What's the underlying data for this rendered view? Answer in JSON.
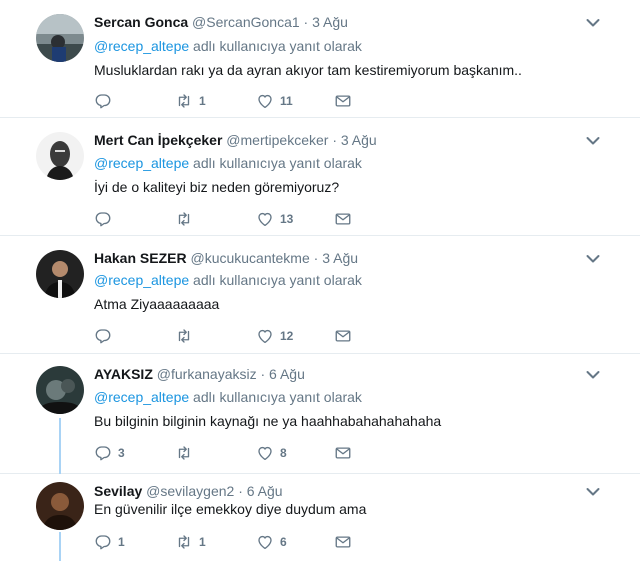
{
  "tweets": [
    {
      "name": "Sercan Gonca",
      "handle": "@SercanGonca1",
      "dot": "·",
      "time": "3 Ağu",
      "reply_mention": "@recep_altepe",
      "reply_suffix": " adlı kullanıcıya yanıt olarak",
      "text": "Musluklardan rakı ya da ayran akıyor tam kestiremiyorum başkanım..",
      "replies": "",
      "retweets": "1",
      "likes": "11"
    },
    {
      "name": "Mert Can İpekçeker",
      "handle": "@mertipekceker",
      "dot": "·",
      "time": "3 Ağu",
      "reply_mention": "@recep_altepe",
      "reply_suffix": " adlı kullanıcıya yanıt olarak",
      "text": "İyi de o kaliteyi biz neden göremiyoruz?",
      "replies": "",
      "retweets": "",
      "likes": "13"
    },
    {
      "name": "Hakan SEZER",
      "handle": "@kucukucantekme",
      "dot": "·",
      "time": "3 Ağu",
      "reply_mention": "@recep_altepe",
      "reply_suffix": " adlı kullanıcıya yanıt olarak",
      "text": "Atma Ziyaaaaaaaaa",
      "replies": "",
      "retweets": "",
      "likes": "12"
    },
    {
      "name": "AYAKSIZ",
      "handle": "@furkanayaksiz",
      "dot": "·",
      "time": "6 Ağu",
      "reply_mention": "@recep_altepe",
      "reply_suffix": " adlı kullanıcıya yanıt olarak",
      "text": "Bu bilginin bilginin kaynağı ne ya haahhabahahahahaha",
      "replies": "3",
      "retweets": "",
      "likes": "8"
    },
    {
      "name": "Sevilay",
      "handle": "@sevilaygen2",
      "dot": "·",
      "time": "6 Ağu",
      "text": "En güvenilir ilçe emekkoy diye duydum ama",
      "replies": "1",
      "retweets": "1",
      "likes": "6"
    }
  ],
  "icons": {
    "reply": "reply-icon",
    "retweet": "retweet-icon",
    "like": "heart-icon",
    "dm": "envelope-icon",
    "more": "chevron-down-icon"
  },
  "colors": {
    "name": "#14171a",
    "muted": "#657786",
    "mention": "#1b95e0",
    "thread_line": "#a9d3f5",
    "divider": "#e6ecf0"
  }
}
